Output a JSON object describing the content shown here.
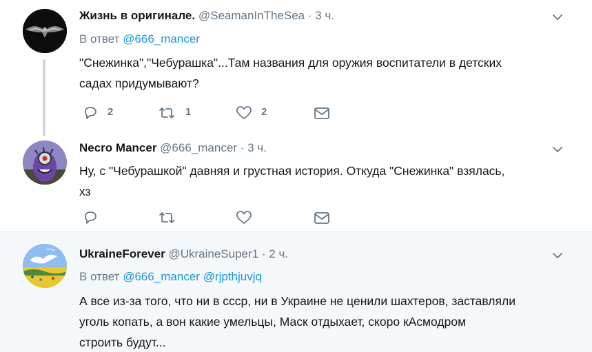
{
  "tweets": [
    {
      "name": "Жизнь в оригинале.",
      "handle": "@SeamanInTheSea",
      "separator": "·",
      "time": "3 ч.",
      "reply_prefix": "В ответ",
      "reply_mentions": [
        "@666_mancer"
      ],
      "text_lines": [
        "\"Снежинка\",\"Чебурашка\"...Там названия для оружия воспитатели в детских",
        "садах придумывают?"
      ],
      "replies": "2",
      "retweets": "1",
      "likes": "2"
    },
    {
      "name": "Necro Mancer",
      "handle": "@666_mancer",
      "separator": "·",
      "time": "3 ч.",
      "text_lines": [
        "Ну, с \"Чебурашкой\" давняя и грустная история. Откуда \"Снежинка\" взялась,",
        "хз"
      ],
      "replies": "",
      "retweets": "",
      "likes": ""
    },
    {
      "name": "UkraineForever",
      "handle": "@UkraineSuper1",
      "separator": "·",
      "time": "2 ч.",
      "reply_prefix": "В ответ",
      "reply_mentions": [
        "@666_mancer",
        "@rjpthjuvjq"
      ],
      "text_lines": [
        "А все из-за того, что ни в ссср, ни в Украине не ценили шахтеров, заставляли",
        "уголь копать, а вон какие умельцы, Маск отдыхает, скоро кАсмодром",
        "строить будут..."
      ]
    }
  ],
  "icons": {
    "caret": "chevron-down-icon",
    "reply": "reply-icon",
    "retweet": "retweet-icon",
    "like": "heart-icon",
    "dm": "envelope-icon"
  },
  "colors": {
    "link": "#1b95e0",
    "muted": "#657786",
    "text": "#14171a",
    "highlight_bg": "#f5f8fa"
  }
}
